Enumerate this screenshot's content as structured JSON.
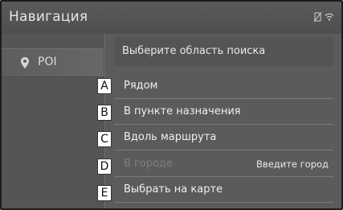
{
  "header": {
    "title": "Навигация"
  },
  "sidebar": {
    "items": [
      {
        "label": "POI"
      }
    ]
  },
  "list": {
    "header": "Выберите область поиска",
    "items": [
      {
        "callout": "A",
        "label": "Рядом",
        "hint": "",
        "enabled": true
      },
      {
        "callout": "B",
        "label": "В пункте назначения",
        "hint": "",
        "enabled": true
      },
      {
        "callout": "C",
        "label": "Вдоль маршрута",
        "hint": "",
        "enabled": true
      },
      {
        "callout": "D",
        "label": "В городе",
        "hint": "Введите город",
        "enabled": false
      },
      {
        "callout": "E",
        "label": "Выбрать на карте",
        "hint": "",
        "enabled": true
      }
    ]
  },
  "icons": {
    "status": [
      "no-sim-icon",
      "wifi-icon"
    ],
    "sidebar": "map-pin-icon"
  }
}
